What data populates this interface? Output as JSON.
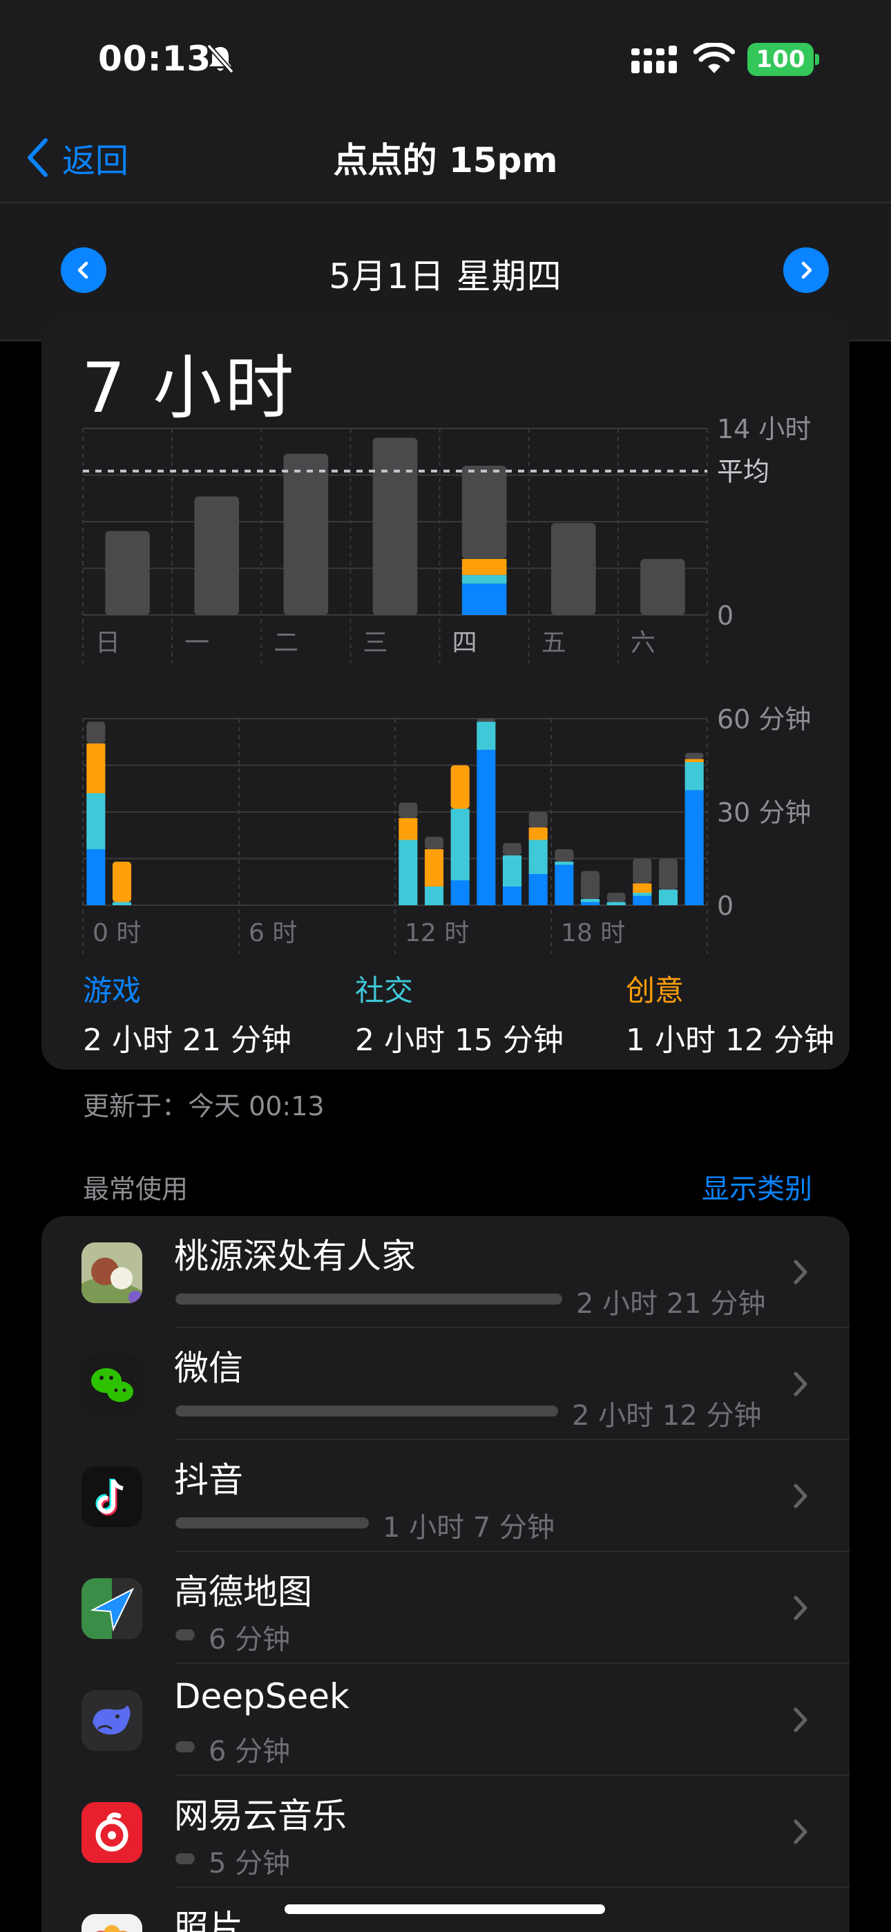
{
  "status": {
    "time": "00:13",
    "battery": "100"
  },
  "nav": {
    "back_label": "返回",
    "title": "点点的 15pm"
  },
  "date": {
    "title": "5月1日 星期四"
  },
  "summary": {
    "total": "7 小时"
  },
  "colors": {
    "games": "#0a84ff",
    "social": "#3fc9d8",
    "creative": "#ff9f0a",
    "other": "#4a4a4c",
    "accent": "#0a84ff"
  },
  "chart_data": [
    {
      "type": "bar",
      "stacked": true,
      "categories": [
        "日",
        "一",
        "二",
        "三",
        "四",
        "五",
        "六"
      ],
      "y_tick_labels": [
        "14 小时",
        "0"
      ],
      "ylim": [
        0,
        14
      ],
      "average_label": "平均",
      "average_hours": 10.8,
      "series": [
        {
          "values": [
            0,
            0,
            0,
            0,
            2.35,
            0,
            0
          ]
        },
        {
          "values": [
            0,
            0,
            0,
            0,
            0.65,
            0,
            0
          ]
        },
        {
          "values": [
            0,
            0,
            0,
            0,
            1.2,
            0,
            0
          ]
        },
        {
          "values": [
            6.3,
            8.9,
            12.1,
            13.3,
            7.0,
            6.9,
            4.2
          ]
        }
      ],
      "highlight_index": 4
    },
    {
      "type": "bar",
      "stacked": true,
      "x_tick_labels": [
        "0 时",
        "6 时",
        "12 时",
        "18 时"
      ],
      "y_tick_labels": [
        "60 分钟",
        "30 分钟",
        "0"
      ],
      "ylim": [
        0,
        60
      ],
      "hours": [
        0,
        1,
        2,
        3,
        4,
        5,
        6,
        7,
        8,
        9,
        10,
        11,
        12,
        13,
        14,
        15,
        16,
        17,
        18,
        19,
        20,
        21,
        22,
        23
      ],
      "series": [
        {
          "name": "游戏",
          "values": [
            18,
            0,
            0,
            0,
            0,
            0,
            0,
            0,
            0,
            0,
            0,
            0,
            0,
            0,
            8,
            50,
            6,
            10,
            13,
            1,
            0,
            3,
            0,
            37
          ]
        },
        {
          "name": "社交",
          "values": [
            18,
            1,
            0,
            0,
            0,
            0,
            0,
            0,
            0,
            0,
            0,
            0,
            21,
            6,
            23,
            9,
            10,
            11,
            1,
            1,
            1,
            1,
            5,
            9
          ]
        },
        {
          "name": "创意",
          "values": [
            16,
            13,
            0,
            0,
            0,
            0,
            0,
            0,
            0,
            0,
            0,
            0,
            7,
            12,
            14,
            0,
            0,
            4,
            0,
            0,
            0,
            3,
            0,
            1
          ]
        },
        {
          "values": [
            7,
            0,
            0,
            0,
            0,
            0,
            0,
            0,
            0,
            0,
            0,
            0,
            5,
            4,
            0,
            1,
            4,
            5,
            4,
            9,
            3,
            8,
            10,
            2
          ]
        }
      ]
    }
  ],
  "categories": [
    {
      "name": "游戏",
      "time": "2 小时 21 分钟"
    },
    {
      "name": "社交",
      "time": "2 小时 15 分钟"
    },
    {
      "name": "创意",
      "time": "1 小时 12 分钟"
    }
  ],
  "updated": "更新于：今天 00:13",
  "most_used": {
    "title": "最常使用",
    "show_categories": "显示类别"
  },
  "apps": [
    {
      "name": "桃源深处有人家",
      "duration": "2 小时 21 分钟",
      "fraction": 1.0,
      "icon": "game-app-icon"
    },
    {
      "name": "微信",
      "duration": "2 小时 12 分钟",
      "fraction": 0.99,
      "icon": "wechat-icon"
    },
    {
      "name": "抖音",
      "duration": "1 小时 7 分钟",
      "fraction": 0.5,
      "icon": "douyin-icon"
    },
    {
      "name": "高德地图",
      "duration": "6 分钟",
      "fraction": 0.045,
      "icon": "amap-icon"
    },
    {
      "name": "DeepSeek",
      "duration": "6 分钟",
      "fraction": 0.045,
      "icon": "deepseek-icon"
    },
    {
      "name": "网易云音乐",
      "duration": "5 分钟",
      "fraction": 0.04,
      "icon": "netease-music-icon"
    },
    {
      "name": "照片",
      "duration": "",
      "fraction": 0,
      "icon": "photos-icon"
    }
  ]
}
